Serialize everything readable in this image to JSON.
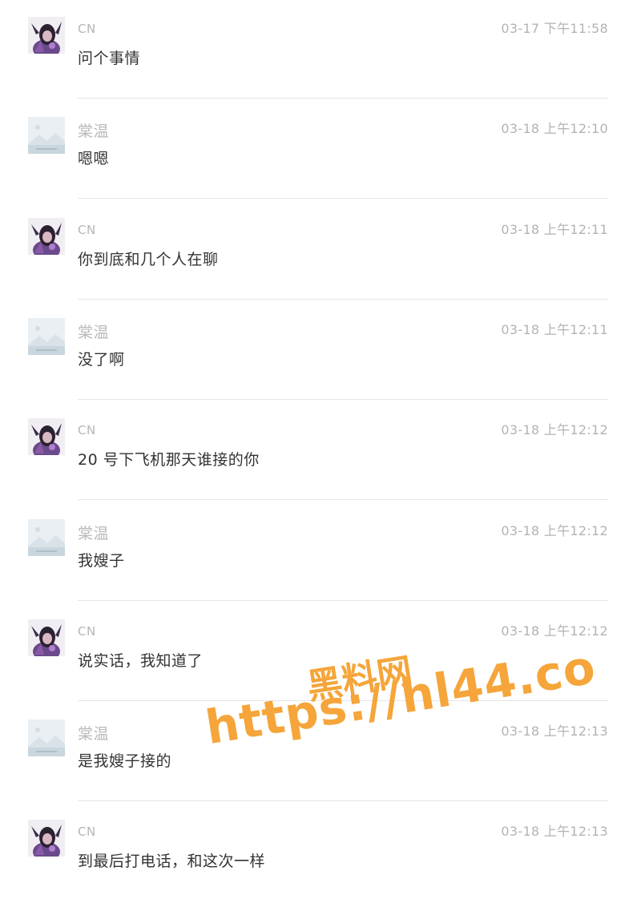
{
  "messages": [
    {
      "sender": "CN",
      "time": "03-17 下午11:58",
      "text": "问个事情",
      "avatar": "cn-avatar-icon"
    },
    {
      "sender": "棠温",
      "time": "03-18 上午12:10",
      "text": "嗯嗯",
      "avatar": "placeholder-image-icon"
    },
    {
      "sender": "CN",
      "time": "03-18 上午12:11",
      "text": "你到底和几个人在聊",
      "avatar": "cn-avatar-icon"
    },
    {
      "sender": "棠温",
      "time": "03-18 上午12:11",
      "text": "没了啊",
      "avatar": "placeholder-image-icon"
    },
    {
      "sender": "CN",
      "time": "03-18 上午12:12",
      "text": "20 号下飞机那天谁接的你",
      "avatar": "cn-avatar-icon"
    },
    {
      "sender": "棠温",
      "time": "03-18 上午12:12",
      "text": "我嫂子",
      "avatar": "placeholder-image-icon"
    },
    {
      "sender": "CN",
      "time": "03-18 上午12:12",
      "text": "说实话，我知道了",
      "avatar": "cn-avatar-icon"
    },
    {
      "sender": "棠温",
      "time": "03-18 上午12:13",
      "text": "是我嫂子接的",
      "avatar": "placeholder-image-icon"
    },
    {
      "sender": "CN",
      "time": "03-18 上午12:13",
      "text": "到最后打电话，和这次一样",
      "avatar": "cn-avatar-icon"
    }
  ],
  "watermark": {
    "title": "黑料网",
    "url": "https://hl44.co"
  },
  "colors": {
    "watermark": "#f5a53a",
    "divider": "#e6e6e6",
    "meta_text": "#b3b3b3",
    "body_text": "#333333"
  }
}
